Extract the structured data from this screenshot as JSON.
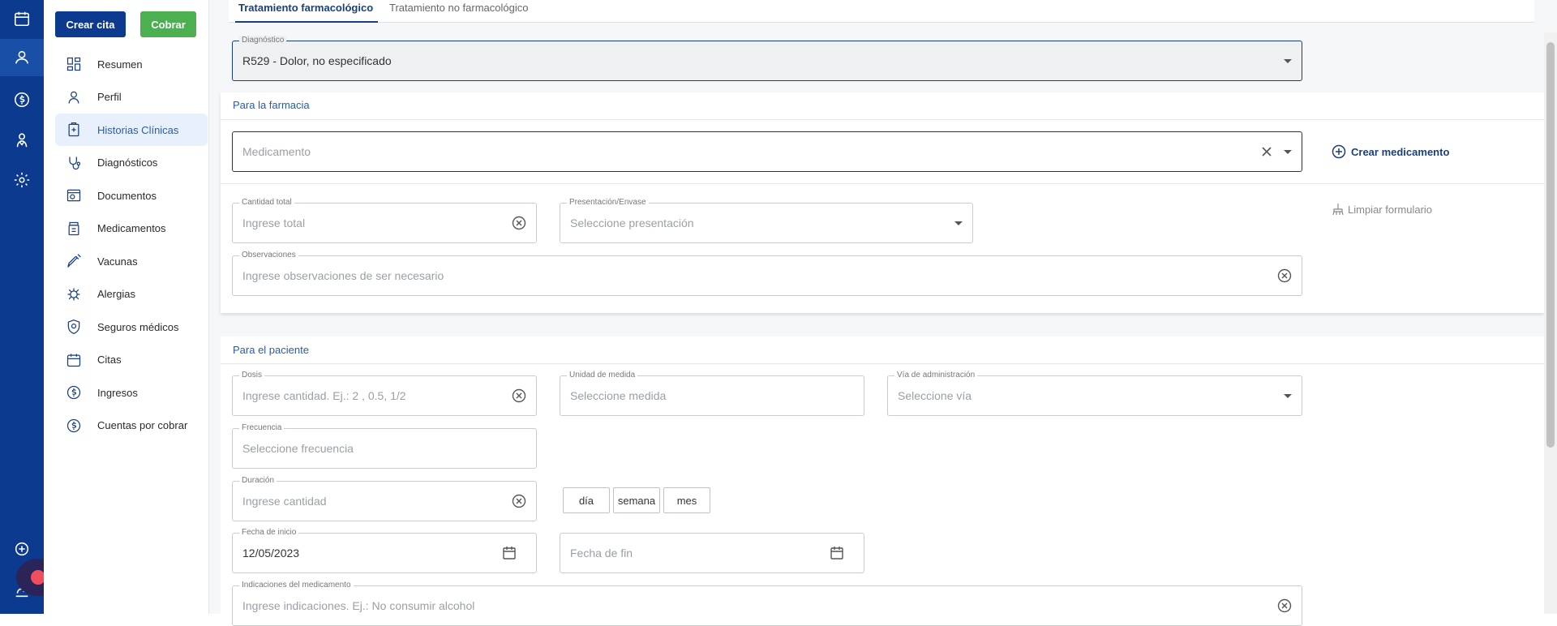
{
  "sidebar": {
    "create_appointment": "Crear cita",
    "charge": "Cobrar",
    "items": [
      {
        "label": "Resumen"
      },
      {
        "label": "Perfil"
      },
      {
        "label": "Historias Clínicas"
      },
      {
        "label": "Diagnósticos"
      },
      {
        "label": "Documentos"
      },
      {
        "label": "Medicamentos"
      },
      {
        "label": "Vacunas"
      },
      {
        "label": "Alergias"
      },
      {
        "label": "Seguros médicos"
      },
      {
        "label": "Citas"
      },
      {
        "label": "Ingresos"
      },
      {
        "label": "Cuentas por cobrar"
      }
    ]
  },
  "tabs": {
    "pharm": "Tratamiento farmacológico",
    "nonpharm": "Tratamiento no farmacológico"
  },
  "diagnosis": {
    "label": "Diagnóstico",
    "value": "R529 - Dolor, no especificado"
  },
  "pharmacy": {
    "title": "Para la farmacia",
    "medication_placeholder": "Medicamento",
    "create_medication": "Crear medicamento",
    "total_label": "Cantidad total",
    "total_placeholder": "Ingrese total",
    "presentation_label": "Presentación/Envase",
    "presentation_placeholder": "Seleccione presentación",
    "clear_form": "Limpiar formulario",
    "observations_label": "Observaciones",
    "observations_placeholder": "Ingrese observaciones de ser necesario"
  },
  "patient": {
    "title": "Para el paciente",
    "dose_label": "Dosis",
    "dose_placeholder": "Ingrese cantidad. Ej.: 2 , 0.5, 1/2",
    "unit_label": "Unidad de medida",
    "unit_placeholder": "Seleccione medida",
    "route_label": "Vía de administración",
    "route_placeholder": "Seleccione vía",
    "frequency_label": "Frecuencia",
    "frequency_placeholder": "Seleccione frecuencia",
    "duration_label": "Duración",
    "duration_placeholder": "Ingrese cantidad",
    "duration_units": [
      "día",
      "semana",
      "mes"
    ],
    "start_label": "Fecha de inicio",
    "start_value": "12/05/2023",
    "end_placeholder": "Fecha de fin",
    "indications_label": "Indicaciones del medicamento",
    "indications_placeholder": "Ingrese indicaciones. Ej.: No consumir alcohol"
  },
  "colors": {
    "brand": "#0b3a8f",
    "success": "#4caf50",
    "active_bg": "#e8f0fb"
  }
}
